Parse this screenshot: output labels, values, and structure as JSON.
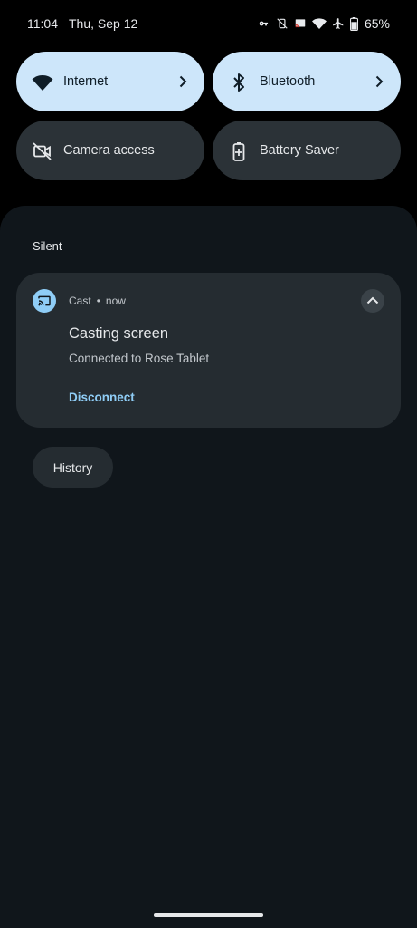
{
  "status_bar": {
    "time": "11:04",
    "date": "Thu, Sep 12",
    "battery_percent": "65%",
    "icons": [
      "vpn-key-icon",
      "vibrate-off-icon",
      "cast-icon",
      "wifi-icon",
      "airplane-icon",
      "battery-icon"
    ]
  },
  "quick_settings": {
    "tiles": [
      {
        "label": "Internet",
        "icon": "wifi-icon",
        "active": true
      },
      {
        "label": "Bluetooth",
        "icon": "bluetooth-icon",
        "active": true
      },
      {
        "label": "Camera access",
        "icon": "camera-off-icon",
        "active": false
      },
      {
        "label": "Battery Saver",
        "icon": "battery-saver-icon",
        "active": false
      }
    ]
  },
  "notifications": {
    "section_label": "Silent",
    "items": [
      {
        "app_name": "Cast",
        "time": "now",
        "title": "Casting screen",
        "text": "Connected to Rose Tablet",
        "action": "Disconnect"
      }
    ],
    "history_label": "History"
  },
  "colors": {
    "tile_active": "#cde6fa",
    "tile_inactive": "#2b3237",
    "shade_bg": "#10161b",
    "card_bg": "#252c31",
    "accent": "#8fcdf6"
  }
}
